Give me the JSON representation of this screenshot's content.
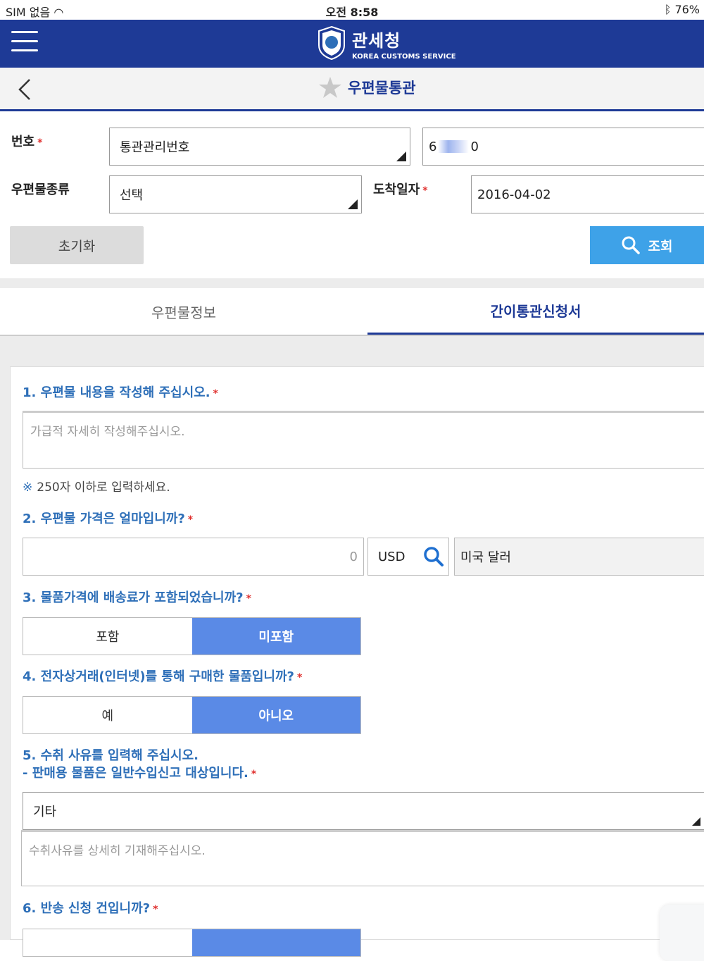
{
  "status": {
    "carrier": "SIM 없음",
    "time": "오전 8:58",
    "battery": "76%"
  },
  "header": {
    "title": "관세청",
    "subtitle": "KOREA CUSTOMS SERVICE"
  },
  "subbar": {
    "title": "우편물통관"
  },
  "form": {
    "number_label": "번호",
    "number_type": "통관관리번호",
    "number_value_start": "6",
    "number_value_end": "0",
    "mail_type_label": "우편물종류",
    "mail_type_value": "선택",
    "arrival_label": "도착일자",
    "arrival_value": "2016-04-02",
    "reset_label": "초기화",
    "search_label": "조회",
    "required_mark": "*"
  },
  "tabs": [
    {
      "label": "우편물정보",
      "active": false
    },
    {
      "label": "간이통관신청서",
      "active": true
    }
  ],
  "application": {
    "q1": "1. 우편물 내용을 작성해 주십시오.",
    "q1_placeholder": "가급적 자세히 작성해주십시오.",
    "note_mark": "※",
    "note": "250자 이하로 입력하세요.",
    "q2": "2. 우편물 가격은 얼마입니까?",
    "price_value": "0",
    "currency_code": "USD",
    "currency_name": "미국 달러",
    "q3": "3. 물품가격에 배송료가 포함되었습니까?",
    "q3_options": [
      "포함",
      "미포함"
    ],
    "q3_selected": "미포함",
    "q4": "4. 전자상거래(인터넷)를 통해 구매한 물품입니까?",
    "q4_options": [
      "예",
      "아니오"
    ],
    "q4_selected": "아니오",
    "q5_line1": "5. 수취 사유를 입력해 주십시오.",
    "q5_line2": "- 판매용 물품은 일반수입신고 대상입니다.",
    "q5_select": "기타",
    "q5_placeholder": "수취사유를 상세히 기재해주십시오.",
    "q6": "6. 반송 신청 건입니까?"
  },
  "colors": {
    "header_bg": "#1e3a96",
    "accent": "#2e6fb8",
    "search_button": "#3ea2e8",
    "toggle_on": "#5a8ae6",
    "required": "#e0312f"
  }
}
